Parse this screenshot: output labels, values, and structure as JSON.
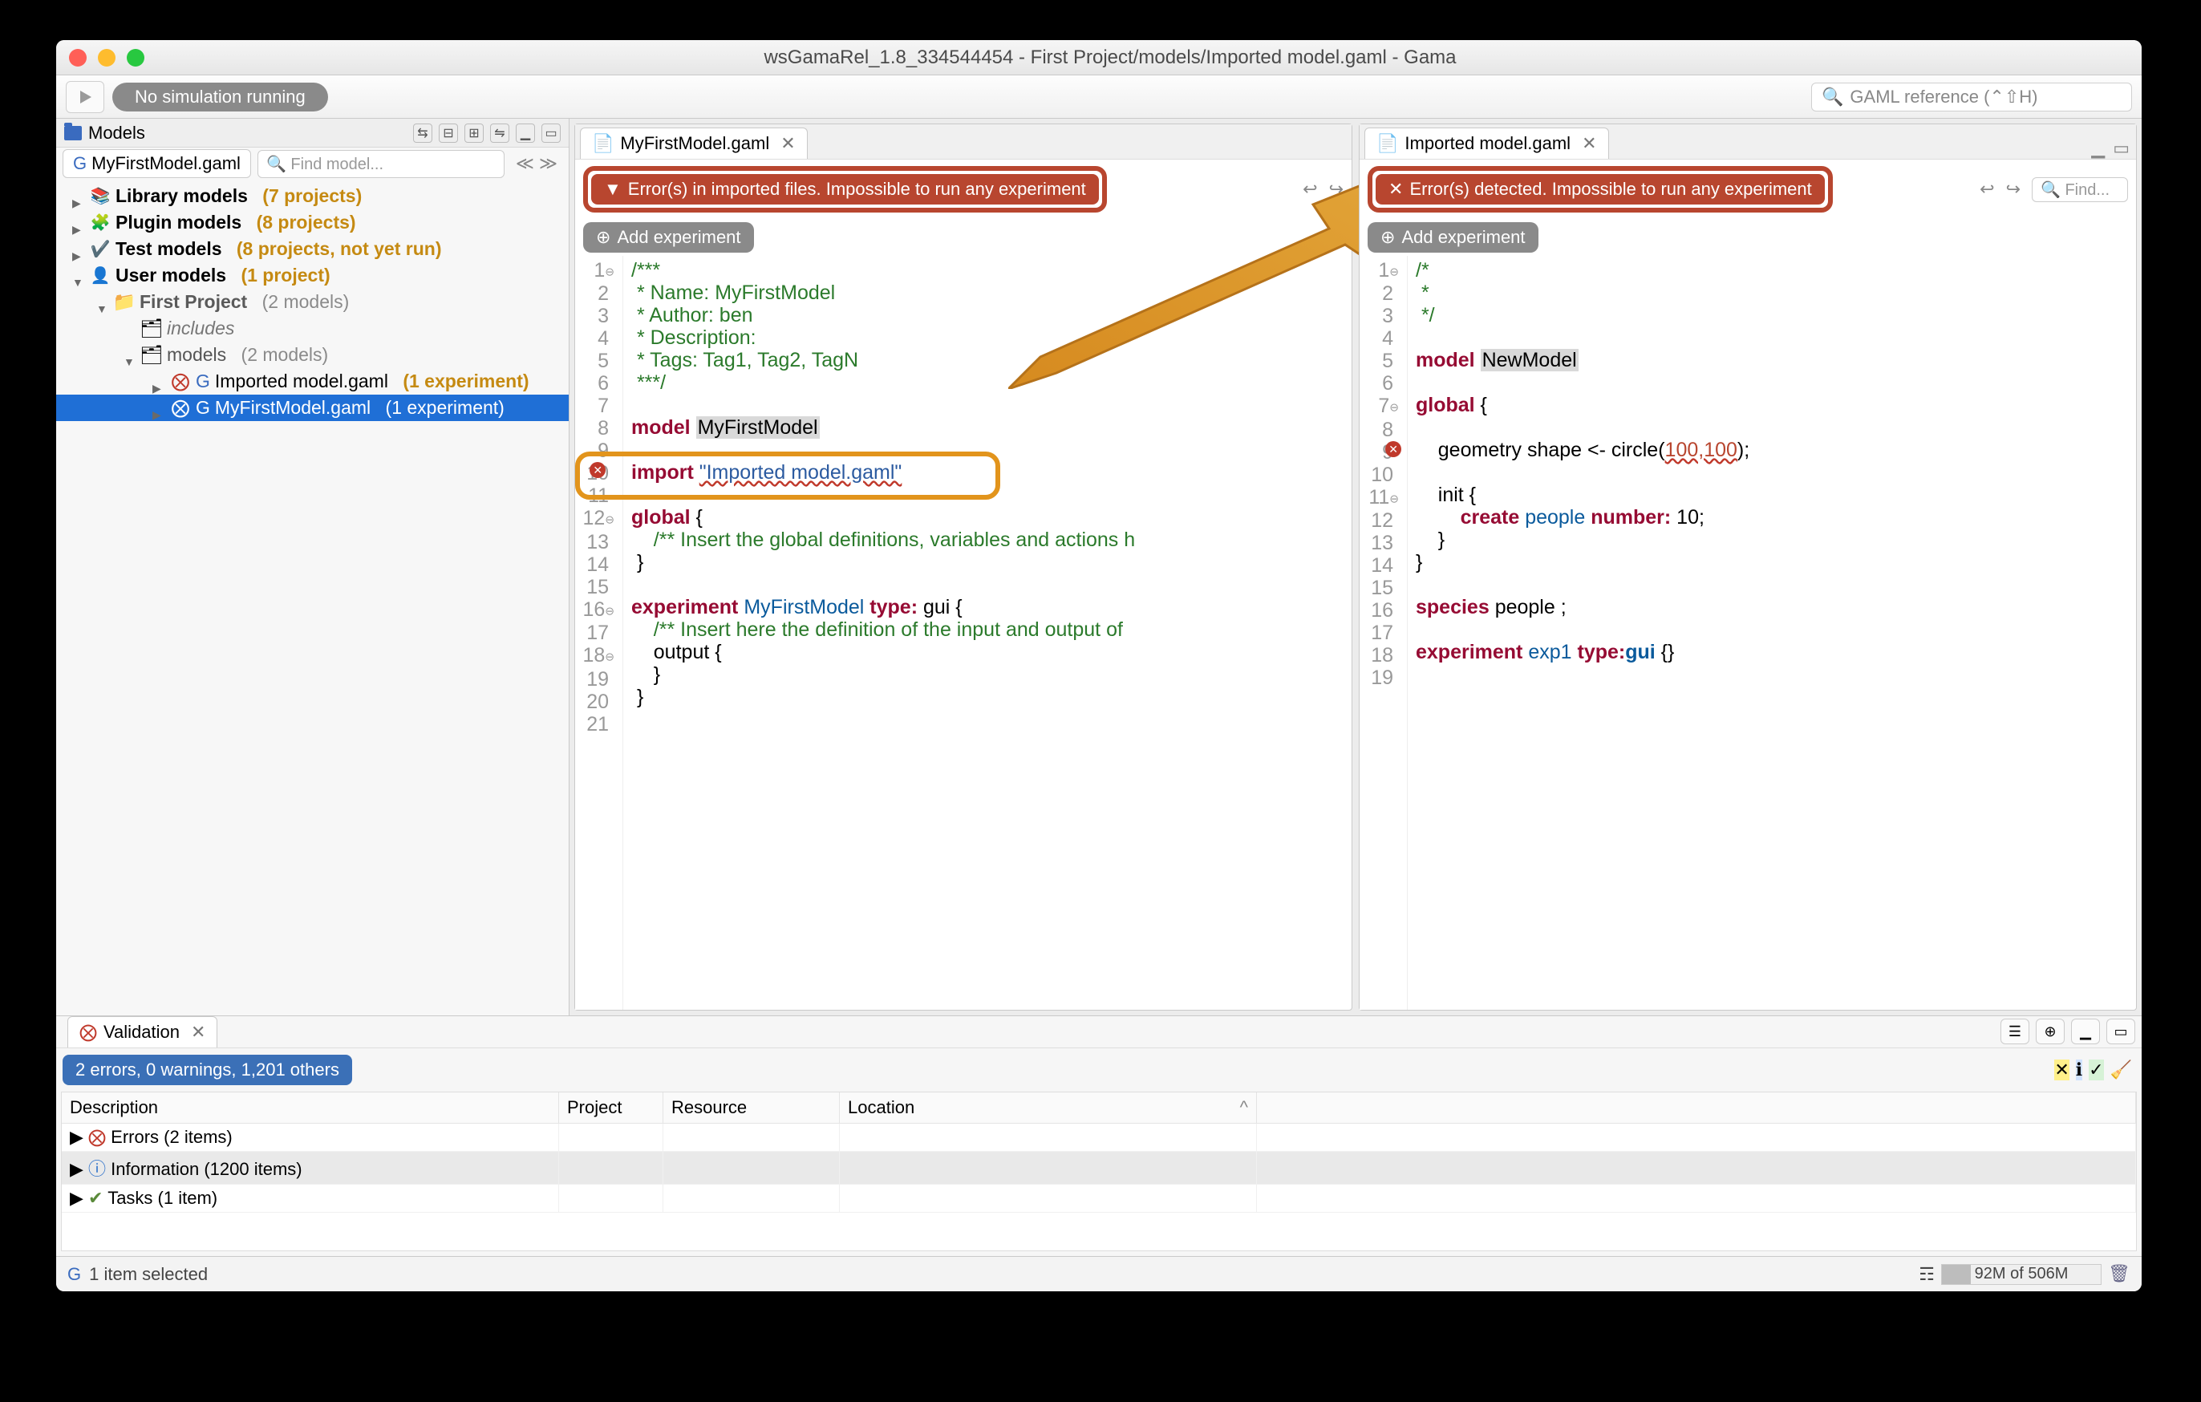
{
  "window_title": "wsGamaRel_1.8_334544454 - First Project/models/Imported model.gaml - Gama",
  "toolbar": {
    "status_pill": "No simulation running",
    "search_placeholder": "GAML reference (⌃⇧H)"
  },
  "models_panel": {
    "title": "Models",
    "crumb": "MyFirstModel.gaml",
    "find_placeholder": "Find model...",
    "tree": {
      "library": {
        "label": "Library models",
        "suffix": "(7 projects)"
      },
      "plugin": {
        "label": "Plugin models",
        "suffix": "(8 projects)"
      },
      "test": {
        "label": "Test models",
        "suffix": "(8 projects, not yet run)"
      },
      "user": {
        "label": "User models",
        "suffix": "(1 project)"
      },
      "first_project": {
        "label": "First Project",
        "suffix": "(2 models)"
      },
      "includes": "includes",
      "models_folder": {
        "label": "models",
        "suffix": "(2 models)"
      },
      "imported": {
        "label": "Imported model.gaml",
        "suffix": "(1 experiment)"
      },
      "myfirst": {
        "label": "MyFirstModel.gaml",
        "suffix": "(1 experiment)"
      }
    }
  },
  "editor1": {
    "tab": "MyFirstModel.gaml",
    "error_banner": "Error(s) in imported files. Impossible to run any experiment",
    "add_exp": "Add experiment",
    "lines": {
      "l1": "/***",
      "l2": " * Name: MyFirstModel",
      "l3": " * Author: ben",
      "l4": " * Description:",
      "l5": " * Tags: Tag1, Tag2, TagN",
      "l6": " ***/",
      "l8_kw": "model",
      "l8_id": "MyFirstModel",
      "l10_kw": "import",
      "l10_str": "\"Imported model.gaml\"",
      "l12_kw": "global",
      "l12_br": " {",
      "l13": "    /** Insert the global definitions, variables and actions h",
      "l14": " }",
      "l16_kw": "experiment",
      "l16_id": "MyFirstModel",
      "l16_kw2": " type:",
      "l16_v": " gui",
      "l16_br": " {",
      "l17": "    /** Insert here the definition of the input and output of",
      "l18": "    output {",
      "l19": "    }",
      "l20": " }"
    }
  },
  "editor2": {
    "tab": "Imported model.gaml",
    "error_banner": "Error(s) detected. Impossible to run any experiment",
    "add_exp": "Add experiment",
    "find_placeholder": "Find...",
    "lines": {
      "l1": "/*",
      "l2": " *",
      "l3": " */",
      "l5_kw": "model",
      "l5_id": "NewModel",
      "l7_kw": "global",
      "l7_br": " {",
      "l9a": "    geometry shape <- circle(",
      "l9b": "100,100",
      "l9c": ");",
      "l11": "    init {",
      "l12a": "        ",
      "l12_kw": "create",
      "l12b": " people ",
      "l12_kw2": "number:",
      "l12c": " 10;",
      "l13": "    }",
      "l14": "}",
      "l16_kw": "species",
      "l16b": " people ;",
      "l18_kw": "experiment",
      "l18b": " exp1 ",
      "l18_kw2": "type:",
      "l18_ty": "gui",
      "l18c": " {}"
    }
  },
  "validation": {
    "title": "Validation",
    "summary": "2 errors, 0 warnings, 1,201 others",
    "headers": {
      "desc": "Description",
      "proj": "Project",
      "res": "Resource",
      "loc": "Location"
    },
    "rows": {
      "errors": "Errors (2 items)",
      "info": "Information (1200 items)",
      "tasks": "Tasks (1 item)"
    }
  },
  "status": {
    "text": "1 item selected",
    "mem": "92M of 506M",
    "mem_pct": 18
  }
}
